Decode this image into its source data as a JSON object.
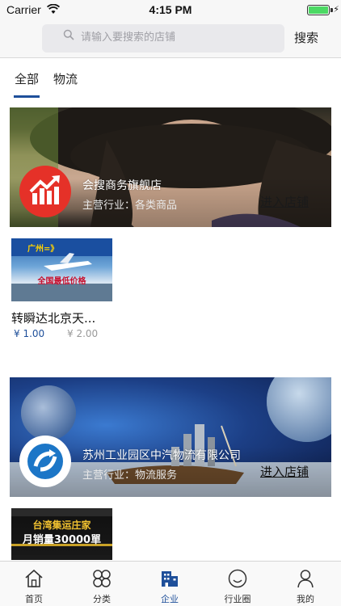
{
  "status_bar": {
    "carrier": "Carrier",
    "time": "4:15 PM",
    "battery_level": 1.0,
    "battery_color": "#4cd964",
    "icons": [
      "wifi-icon",
      "battery-icon",
      "charging-icon"
    ]
  },
  "search": {
    "placeholder": "请输入要搜索的店铺",
    "button_label": "搜索",
    "icon": "search-icon"
  },
  "tabs": [
    {
      "label": "全部",
      "active": true
    },
    {
      "label": "物流",
      "active": false
    }
  ],
  "accent_color": "#1e4f9a",
  "shops": [
    {
      "name": "会搜商务旗舰店",
      "industry": "主营行业：各类商品",
      "enter_label": "进入店铺",
      "logo_icon": "growth-chart-logo-icon",
      "products": [
        {
          "title": "转瞬达北京天...",
          "price": "¥ 1.00",
          "original_price": "¥ 2.00",
          "image_text": [
            "广州=》",
            "全国最低价格"
          ]
        }
      ]
    },
    {
      "name": "苏州工业园区中汽物流有限公司",
      "industry": "主营行业：物流服务",
      "enter_label": "进入店铺",
      "logo_icon": "circular-arrow-logo-icon",
      "products": [
        {
          "image_text": [
            "台湾集运庄家",
            "月销量30000單"
          ]
        }
      ]
    }
  ],
  "tab_bar": [
    {
      "label": "首页",
      "icon": "home-icon",
      "active": false
    },
    {
      "label": "分类",
      "icon": "category-grid-icon",
      "active": false
    },
    {
      "label": "企业",
      "icon": "company-building-icon",
      "active": true
    },
    {
      "label": "行业圈",
      "icon": "smiley-circle-icon",
      "active": false
    },
    {
      "label": "我的",
      "icon": "profile-icon",
      "active": false
    }
  ]
}
